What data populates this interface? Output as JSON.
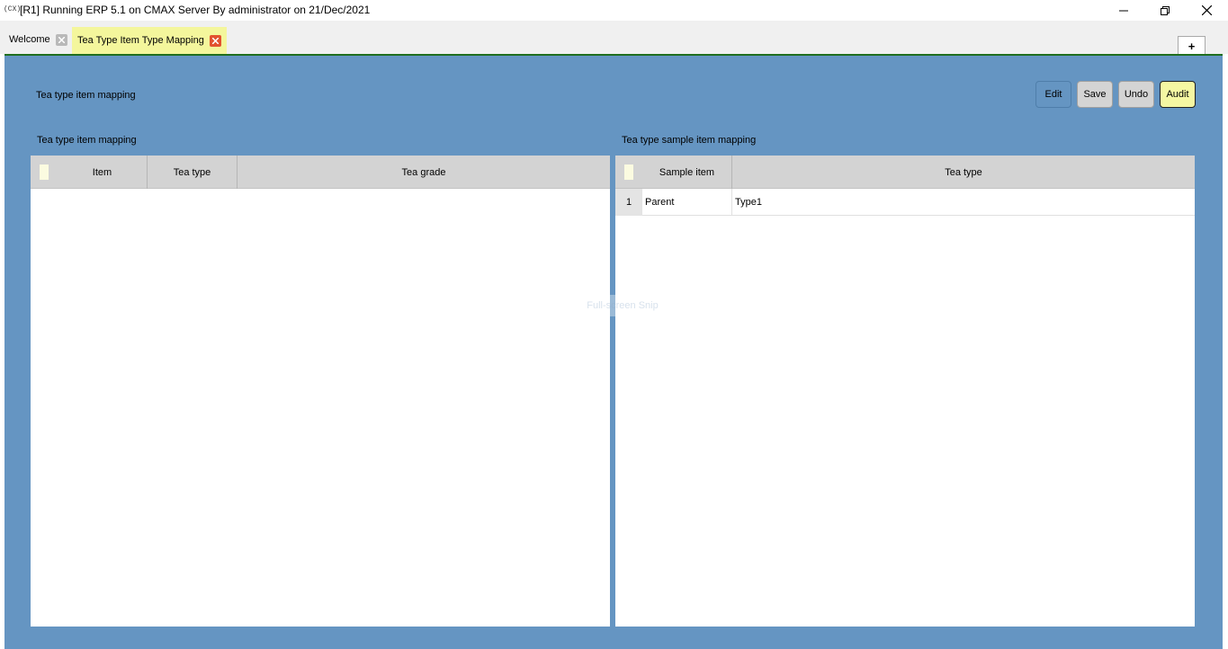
{
  "window": {
    "icon_text": "(CX)",
    "title": "[R1] Running ERP 5.1 on CMAX Server By administrator on 21/Dec/2021"
  },
  "tabs": [
    {
      "label": "Welcome",
      "active": false
    },
    {
      "label": "Tea Type Item Type Mapping",
      "active": true
    }
  ],
  "tabstrip": {
    "add_label": "+"
  },
  "panel": {
    "title": "Tea type item mapping",
    "toolbar": {
      "edit_label": "Edit",
      "save_label": "Save",
      "undo_label": "Undo",
      "audit_label": "Audit"
    },
    "faint_overlay": "Full-screen Snip"
  },
  "left_grid": {
    "label": "Tea type item mapping",
    "columns": [
      "Item",
      "Tea type",
      "Tea grade"
    ],
    "rows": []
  },
  "right_grid": {
    "label": "Tea type sample item mapping",
    "columns": [
      "Sample item",
      "Tea type"
    ],
    "rows": [
      {
        "index": "1",
        "sample_item": "Parent",
        "tea_type": "Type1"
      }
    ]
  },
  "colors": {
    "panel_bg": "#6595c2",
    "active_tab": "#f4f69c",
    "audit_button": "#f5f7a2",
    "tab_close_active": "#e2522f",
    "accent_line": "#1f6e1f"
  }
}
